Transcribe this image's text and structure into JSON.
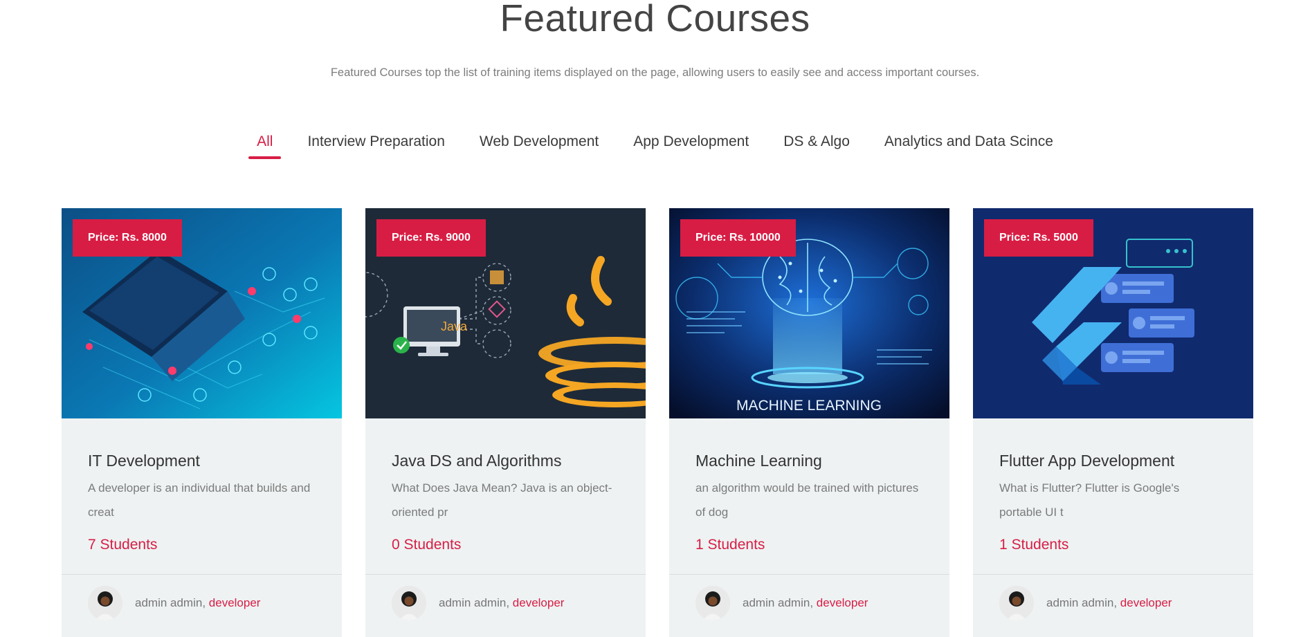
{
  "header": {
    "title": "Featured Courses",
    "subtitle": "Featured Courses top the list of training items displayed on the page, allowing users to easily see and access important courses."
  },
  "tabs": [
    {
      "label": "All",
      "active": true
    },
    {
      "label": "Interview Preparation",
      "active": false
    },
    {
      "label": "Web Development",
      "active": false
    },
    {
      "label": "App Development",
      "active": false
    },
    {
      "label": "DS & Algo",
      "active": false
    },
    {
      "label": "Analytics and Data Scince",
      "active": false
    }
  ],
  "accent_color": "#d81d44",
  "courses": [
    {
      "price": "Price: Rs. 8000",
      "title": "IT Development",
      "description": "A developer is an individual that builds and creat",
      "students": "7 Students",
      "author": "admin admin",
      "role": "developer",
      "image_icon": "laptop-circuit-illustration"
    },
    {
      "price": "Price: Rs. 9000",
      "title": "Java DS and Algorithms",
      "description": "What Does Java Mean? Java is an object-oriented pr",
      "students": "0 Students",
      "author": "admin admin",
      "role": "developer",
      "image_icon": "java-logo-illustration",
      "image_text": "Java"
    },
    {
      "price": "Price: Rs. 10000",
      "title": "Machine Learning",
      "description": "an algorithm would be trained with pictures of dog",
      "students": "1 Students",
      "author": "admin admin",
      "role": "developer",
      "image_icon": "ai-brain-illustration",
      "image_text": "MACHINE LEARNING"
    },
    {
      "price": "Price: Rs. 5000",
      "title": "Flutter App Development",
      "description": "What is Flutter? Flutter is Google's portable UI t",
      "students": "1 Students",
      "author": "admin admin",
      "role": "developer",
      "image_icon": "flutter-logo-illustration"
    }
  ]
}
